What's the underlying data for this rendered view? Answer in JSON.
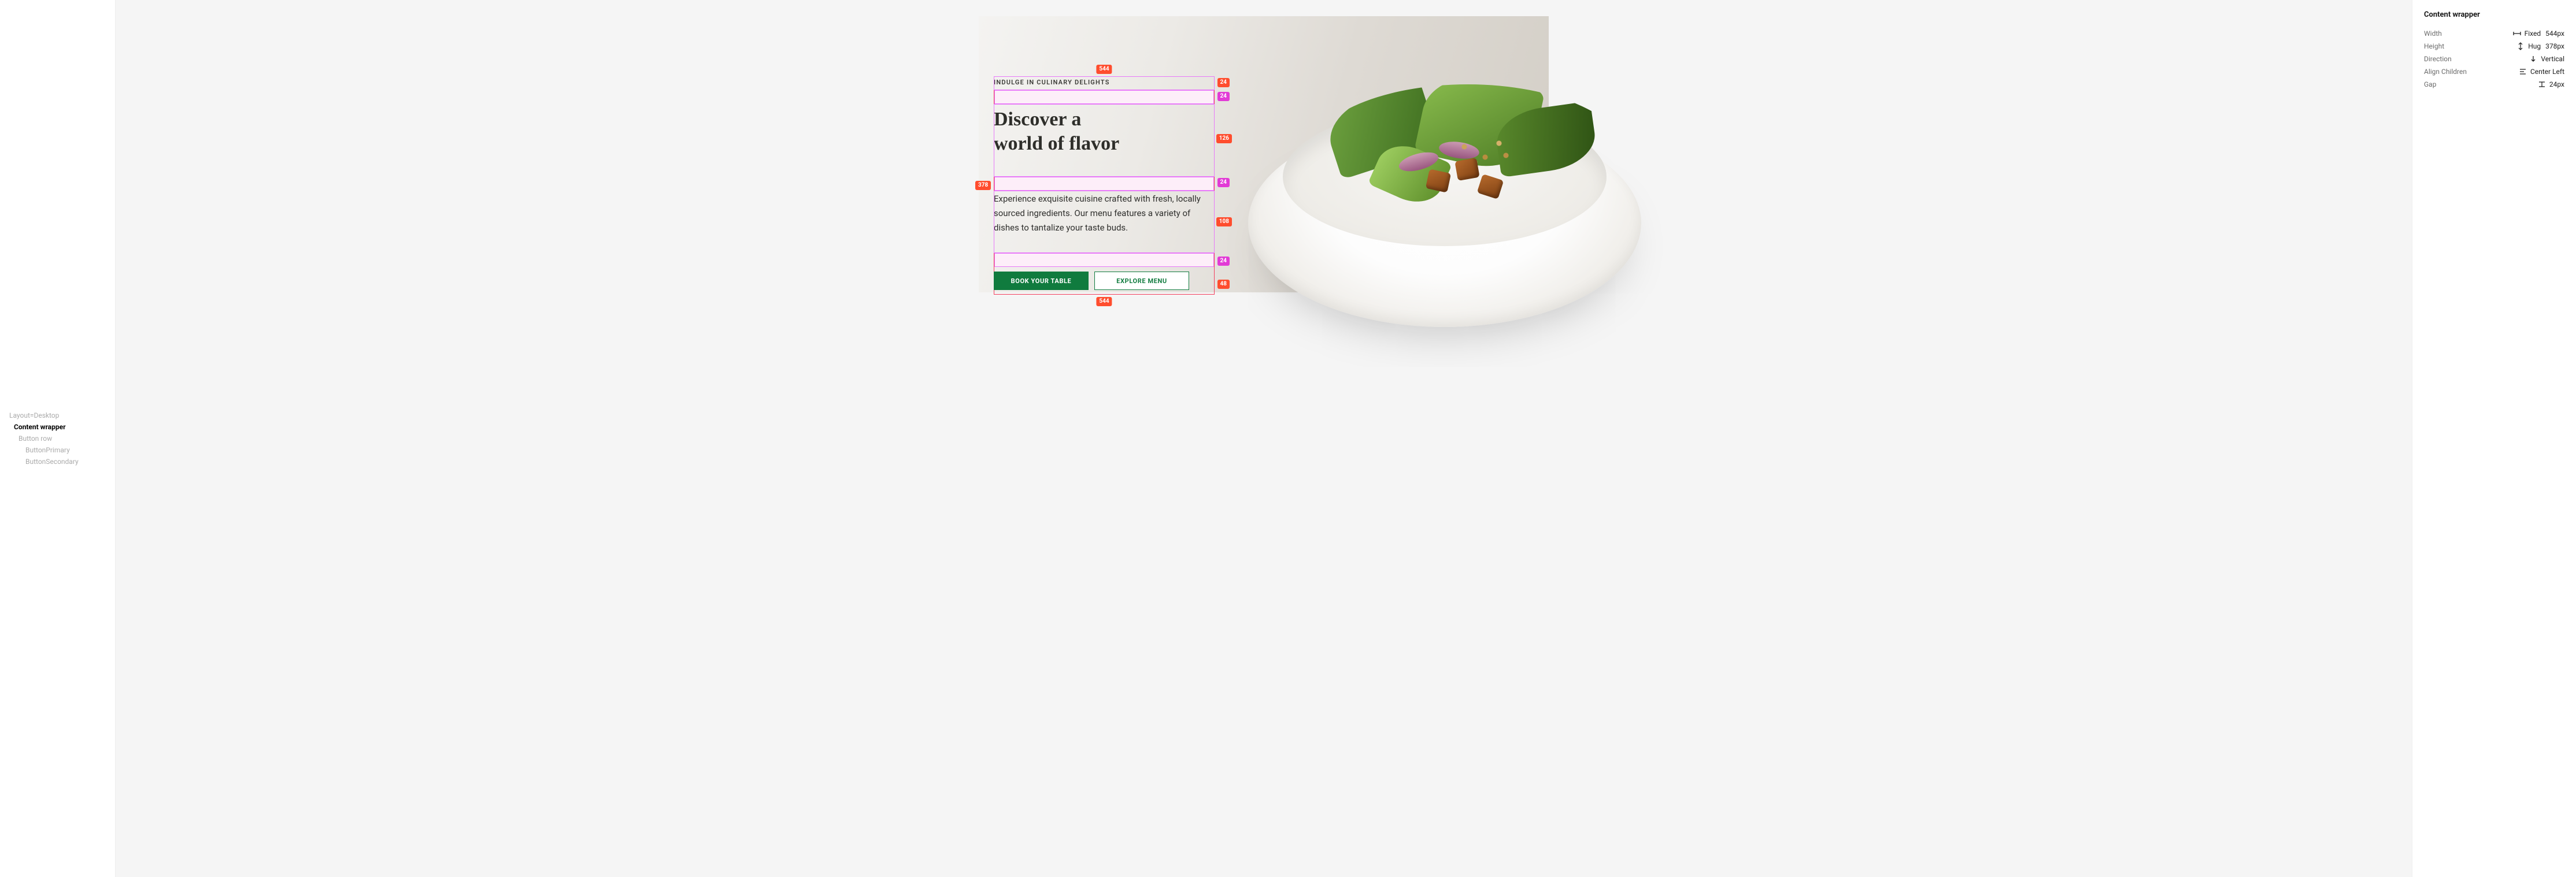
{
  "layers": {
    "root": "Layout=Desktop",
    "selected": "Content wrapper",
    "children": [
      {
        "name": "Button row",
        "children": [
          {
            "name": "ButtonPrimary"
          },
          {
            "name": "ButtonSecondary"
          }
        ]
      }
    ]
  },
  "content": {
    "eyebrow": "INDULGE IN CULINARY DELIGHTS",
    "headline_line1": "Discover a",
    "headline_line2": "world of flavor",
    "body": "Experience exquisite cuisine crafted with fresh, locally sourced ingredients. Our menu features a variety of dishes to tantalize your taste buds.",
    "cta_primary": "BOOK YOUR TABLE",
    "cta_secondary": "EXPLORE MENU"
  },
  "measurements": {
    "width_top": "544",
    "width_bottom": "544",
    "height_left": "378",
    "rows": {
      "eyebrow_h": "24",
      "gap1": "24",
      "headline_h": "126",
      "gap2": "24",
      "body_h": "108",
      "gap3": "24",
      "buttons_h": "48"
    }
  },
  "inspector": {
    "title": "Content wrapper",
    "width_label": "Width",
    "width_mode": "Fixed",
    "width_value": "544px",
    "height_label": "Height",
    "height_mode": "Hug",
    "height_value": "378px",
    "direction_label": "Direction",
    "direction_value": "Vertical",
    "align_label": "Align Children",
    "align_value": "Center Left",
    "gap_label": "Gap",
    "gap_value": "24px"
  }
}
